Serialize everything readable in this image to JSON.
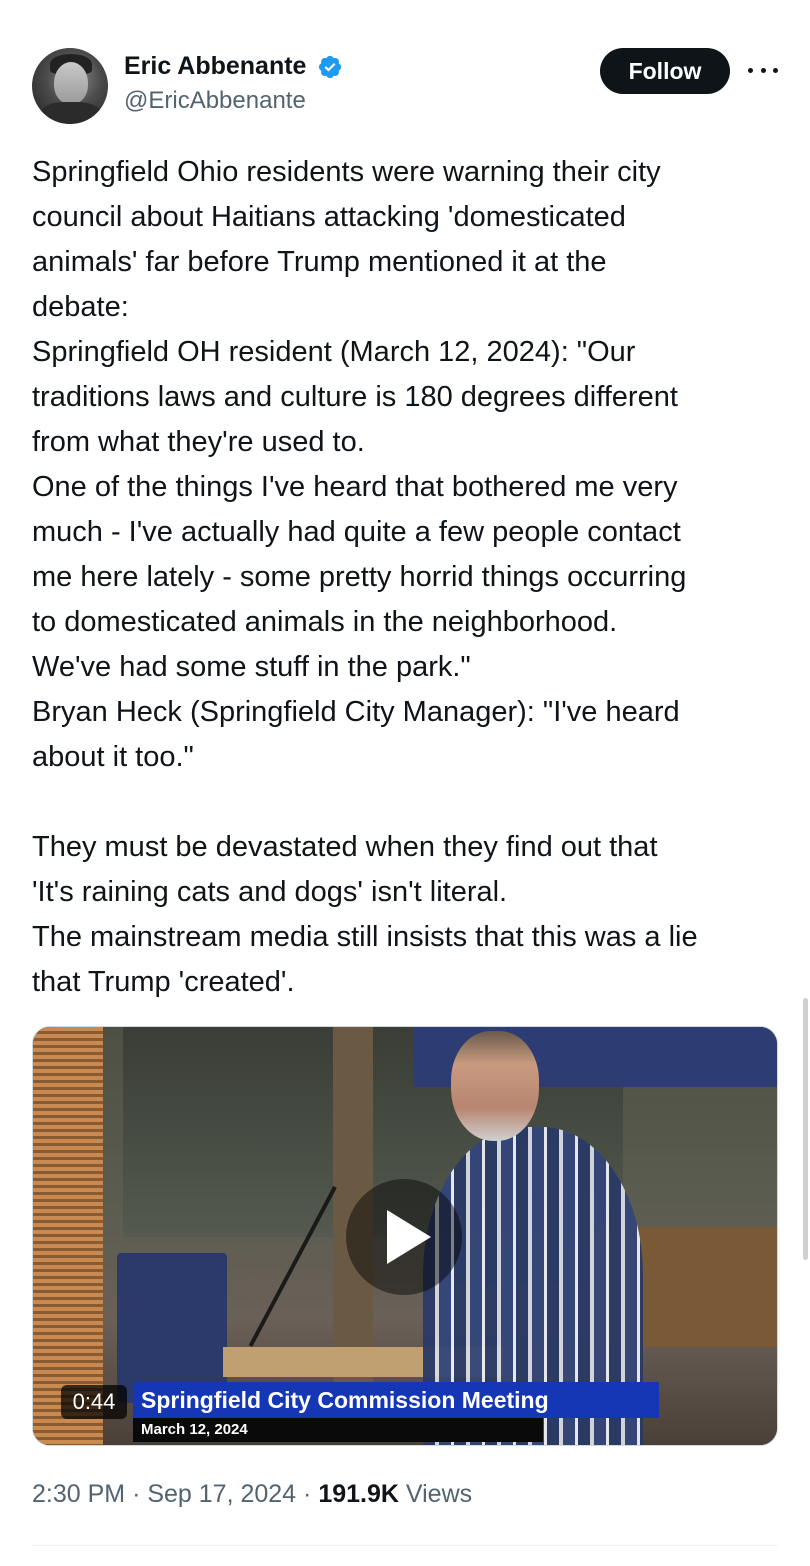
{
  "author": {
    "display_name": "Eric Abbenante",
    "handle": "@EricAbbenante",
    "verified_icon": "verified-badge-icon",
    "verified_color": "#1d9bf0"
  },
  "actions": {
    "follow_label": "Follow",
    "more_icon": "more-options-icon"
  },
  "tweet": {
    "text": "Springfield Ohio residents were warning their city\ncouncil about Haitians attacking 'domesticated\nanimals' far before Trump mentioned it at the\ndebate:\nSpringfield OH resident (March 12, 2024): \"Our\ntraditions laws and culture is 180 degrees different\nfrom what they're used to.\nOne of the things I've heard that bothered me very\nmuch - I've actually had quite a few people contact\nme here lately - some pretty horrid things occurring\nto domesticated animals in the neighborhood.\nWe've had some stuff in the park.\"\nBryan Heck (Springfield City Manager): \"I've heard\nabout it too.\"\n\nThey must be devastated when they find out that\n'It's raining cats and dogs' isn't literal.\nThe mainstream media still insists that this was a lie\nthat Trump 'created'."
  },
  "video": {
    "duration": "0:44",
    "caption_title": "Springfield City Commission Meeting",
    "caption_date": "March 12, 2024",
    "play_icon": "play-icon"
  },
  "meta": {
    "time": "2:30 PM",
    "separator": "·",
    "date": "Sep 17, 2024",
    "views_count": "191.9K",
    "views_label": "Views"
  },
  "colors": {
    "text_primary": "#0f1419",
    "text_secondary": "#536471",
    "follow_bg": "#0f1419",
    "caption_blue": "#1637b5"
  }
}
